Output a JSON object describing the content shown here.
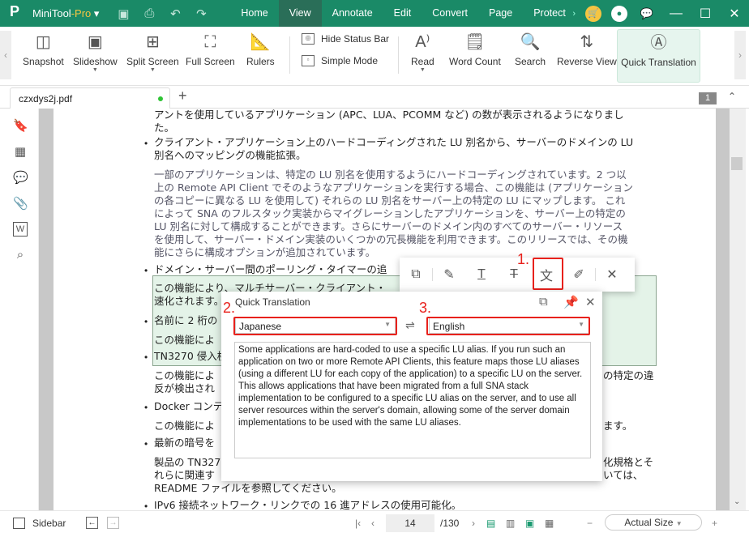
{
  "app": {
    "name": "MiniTool",
    "edition": "-Pro"
  },
  "menu": [
    "Home",
    "View",
    "Annotate",
    "Edit",
    "Convert",
    "Page",
    "Protect"
  ],
  "menu_active": "View",
  "ribbon": {
    "snapshot": "Snapshot",
    "slideshow": "Slideshow",
    "split_screen": "Split Screen",
    "full_screen": "Full Screen",
    "rulers": "Rulers",
    "hide_status_bar": "Hide Status Bar",
    "simple_mode": "Simple Mode",
    "read": "Read",
    "word_count": "Word Count",
    "search": "Search",
    "reverse_view": "Reverse View",
    "quick_translation": "Quick Translation"
  },
  "tab": {
    "filename": "czxdys2j.pdf",
    "page_badge": "1"
  },
  "document": {
    "lines": [
      "アントを使用しているアプリケーション (APC、LUA、PCOMM など) の数が表示されるようになりまし",
      "た。",
      "クライアント・アプリケーション上のハードコーディングされた LU 別名から、サーバーのドメインの LU",
      "別名へのマッピングの機能拡張。",
      "一部のアプリケーションは、特定の LU 別名を使用するようにハードコーディングされています。2 つ以",
      "上の Remote API Client でそのようなアプリケーションを実行する場合、この機能は (アプリケーション",
      "の各コピーに異なる LU を使用して) それらの LU 別名をサーバー上の特定の LU にマップします。 これ",
      "によって SNA のフルスタック実装からマイグレーションしたアプリケーションを、サーバー上の特定の",
      "LU 別名に対して構成することができます。さらにサーバーのドメイン内のすべてのサーバー・リソース",
      "を使用して、サーバー・ドメイン実装のいくつかの冗長機能を利用できます。このリリースでは、その機",
      "能にさらに構成オプションが追加されています。",
      "ドメイン・サーバー間のポーリング・タイマーの追",
      "この機能により、マルチサーバー・クライアント・",
      "速化されます。",
      "名前に 2 桁の",
      "この機能によ",
      "TN3270 侵入検",
      "この機能によ",
      "反が検出され",
      "Docker コンテ",
      "この機能によ",
      "最新の暗号を",
      "製品の TN327",
      "れらに関連す",
      "README ファイルを参照してください。",
      "IPv6 接続ネットワーク・リンクでの 16 進アドレスの使用可能化。"
    ],
    "right_fragments": [
      "が迅",
      "の特定の違",
      "ます。",
      "化規格とそ",
      "いては、"
    ]
  },
  "annotations": {
    "step1": "1.",
    "step2": "2.",
    "step3": "3."
  },
  "quick_translation": {
    "title": "Quick Translation",
    "source_lang": "Japanese",
    "target_lang": "English",
    "output": "Some applications are hard-coded to use a specific LU alias. If you run such an application on two or more Remote API Clients, this feature maps those LU aliases (using a different LU for each copy of the application) to a specific LU on the server. This allows applications that have been migrated from a full SNA stack implementation to be configured to a specific LU alias on the server, and to use all server resources within the server's domain, allowing some of the server domain implementations to be used with the same LU aliases."
  },
  "statusbar": {
    "sidebar": "Sidebar",
    "current_page": "14",
    "total_pages": "/130",
    "zoom": "Actual Size"
  },
  "colors": {
    "brand": "#1a8a67",
    "highlight": "#e4f3e8",
    "annotation_red": "#e8211c"
  }
}
